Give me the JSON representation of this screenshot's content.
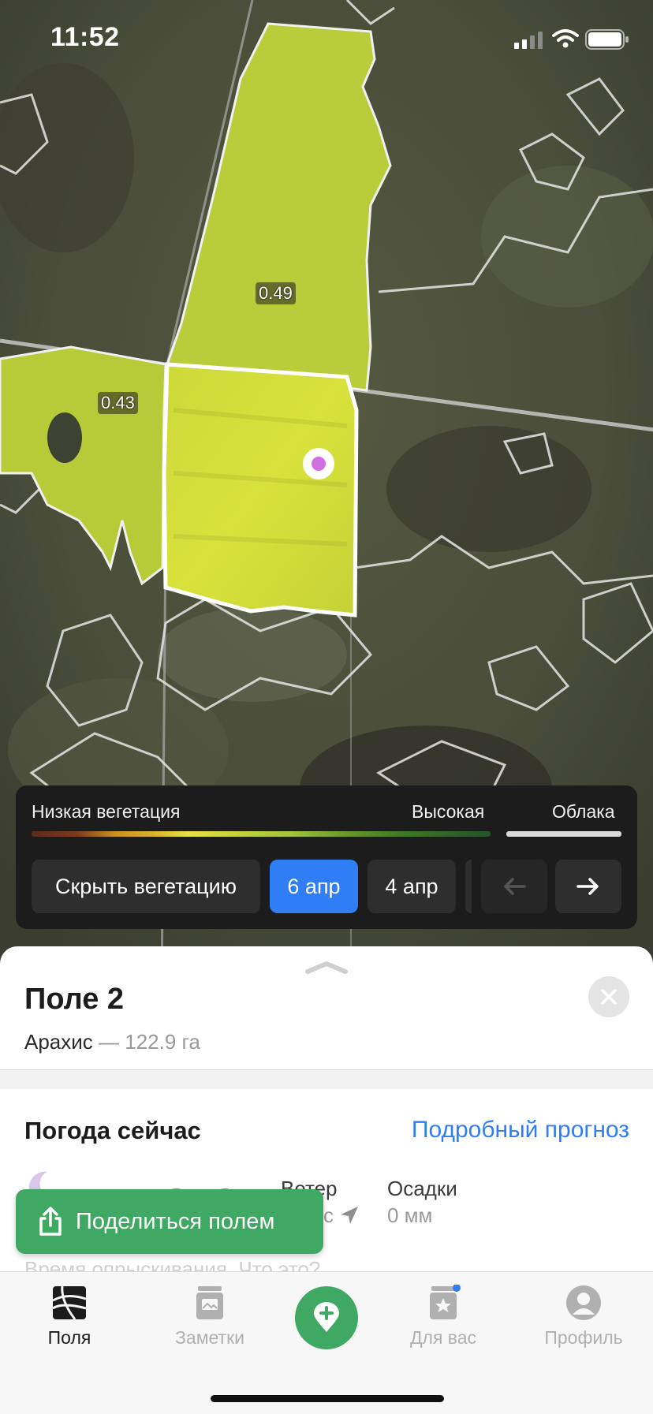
{
  "status_bar": {
    "time": "11:52"
  },
  "map": {
    "field_labels": [
      "0.49",
      "0.43"
    ],
    "colors": {
      "field_fill": "#b9cc3a",
      "selected_fill": "#d3e03a",
      "boundary": "#f2f2f2",
      "marker": "#d070e0"
    }
  },
  "vegetation_panel": {
    "low_label": "Низкая вегетация",
    "high_label": "Высокая",
    "clouds_label": "Облака",
    "hide_button": "Скрыть вегетацию",
    "dates": [
      "6 апр",
      "4 апр"
    ],
    "active_date": "6 апр",
    "prev_icon": "arrow-left-icon",
    "next_icon": "arrow-right-icon"
  },
  "field": {
    "name": "Поле 2",
    "crop": "Арахис",
    "separator": " — ",
    "area": "122.9 га"
  },
  "weather": {
    "title": "Погода сейчас",
    "forecast_link": "Подробный прогноз",
    "wind_label": "Ветер",
    "wind_value": "с",
    "precip_label": "Осадки",
    "precip_value": "0 мм",
    "hidden_line": "Время опрыскивания. Что это?"
  },
  "share_button": {
    "label": "Поделиться полем"
  },
  "tabbar": {
    "tabs": [
      {
        "label": "Поля",
        "icon": "fields-icon"
      },
      {
        "label": "Заметки",
        "icon": "notes-icon"
      },
      {
        "label": "",
        "icon": "add-note-icon"
      },
      {
        "label": "Для вас",
        "icon": "for-you-icon"
      },
      {
        "label": "Профиль",
        "icon": "profile-icon"
      }
    ],
    "active_tab": "Поля",
    "accent": "#3fa862",
    "badge_color": "#2f7ef5"
  }
}
